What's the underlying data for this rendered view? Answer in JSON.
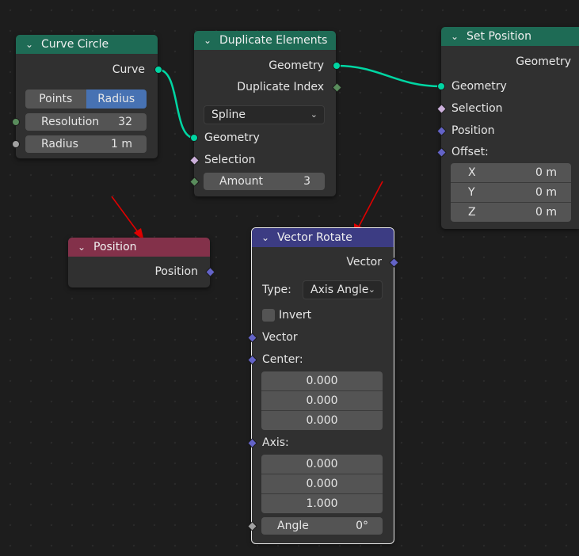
{
  "nodes": {
    "curve_circle": {
      "title": "Curve Circle",
      "output_curve": "Curve",
      "mode_options": [
        "Points",
        "Radius"
      ],
      "mode_selected": "Radius",
      "resolution_label": "Resolution",
      "resolution_value": "32",
      "radius_label": "Radius",
      "radius_value": "1 m"
    },
    "duplicate_elements": {
      "title": "Duplicate Elements",
      "output_geometry": "Geometry",
      "output_duplicate_index": "Duplicate Index",
      "domain_value": "Spline",
      "input_geometry": "Geometry",
      "input_selection": "Selection",
      "amount_label": "Amount",
      "amount_value": "3"
    },
    "set_position": {
      "title": "Set Position",
      "output_geometry": "Geometry",
      "input_geometry": "Geometry",
      "input_selection": "Selection",
      "input_position": "Position",
      "input_offset": "Offset:",
      "offset": [
        {
          "label": "X",
          "value": "0 m"
        },
        {
          "label": "Y",
          "value": "0 m"
        },
        {
          "label": "Z",
          "value": "0 m"
        }
      ]
    },
    "position": {
      "title": "Position",
      "output_position": "Position"
    },
    "vector_rotate": {
      "title": "Vector Rotate",
      "output_vector": "Vector",
      "type_label": "Type:",
      "type_value": "Axis Angle",
      "invert_label": "Invert",
      "invert_checked": false,
      "input_vector": "Vector",
      "center_label": "Center:",
      "center": [
        "0.000",
        "0.000",
        "0.000"
      ],
      "axis_label": "Axis:",
      "axis": [
        "0.000",
        "0.000",
        "1.000"
      ],
      "angle_label": "Angle",
      "angle_value": "0°"
    }
  },
  "colors": {
    "geometry_header": "#1e6b55",
    "input_header": "#83314a",
    "vector_header": "#3c3c83",
    "geometry_socket": "#00d6a3",
    "vector_socket": "#6363c7",
    "annotation_arrow": "#e00000"
  },
  "icons": [
    "chevron-down-icon",
    "dropdown-arrow-icon"
  ]
}
